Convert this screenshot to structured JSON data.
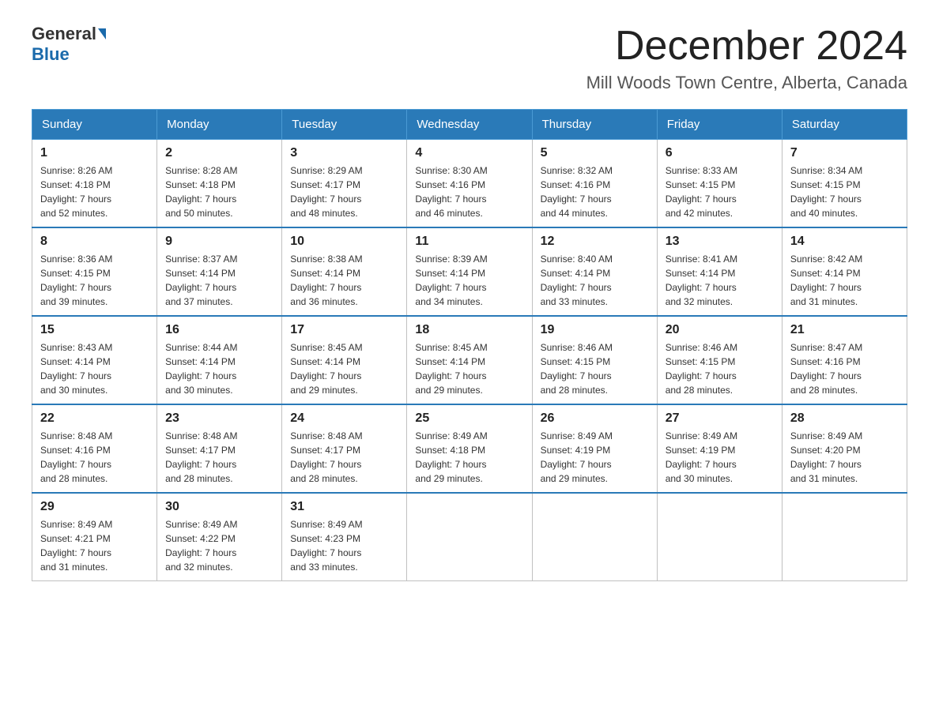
{
  "header": {
    "logo_general": "General",
    "logo_blue": "Blue",
    "month_title": "December 2024",
    "location": "Mill Woods Town Centre, Alberta, Canada"
  },
  "weekdays": [
    "Sunday",
    "Monday",
    "Tuesday",
    "Wednesday",
    "Thursday",
    "Friday",
    "Saturday"
  ],
  "weeks": [
    [
      {
        "day": "1",
        "sunrise": "8:26 AM",
        "sunset": "4:18 PM",
        "daylight": "7 hours and 52 minutes."
      },
      {
        "day": "2",
        "sunrise": "8:28 AM",
        "sunset": "4:18 PM",
        "daylight": "7 hours and 50 minutes."
      },
      {
        "day": "3",
        "sunrise": "8:29 AM",
        "sunset": "4:17 PM",
        "daylight": "7 hours and 48 minutes."
      },
      {
        "day": "4",
        "sunrise": "8:30 AM",
        "sunset": "4:16 PM",
        "daylight": "7 hours and 46 minutes."
      },
      {
        "day": "5",
        "sunrise": "8:32 AM",
        "sunset": "4:16 PM",
        "daylight": "7 hours and 44 minutes."
      },
      {
        "day": "6",
        "sunrise": "8:33 AM",
        "sunset": "4:15 PM",
        "daylight": "7 hours and 42 minutes."
      },
      {
        "day": "7",
        "sunrise": "8:34 AM",
        "sunset": "4:15 PM",
        "daylight": "7 hours and 40 minutes."
      }
    ],
    [
      {
        "day": "8",
        "sunrise": "8:36 AM",
        "sunset": "4:15 PM",
        "daylight": "7 hours and 39 minutes."
      },
      {
        "day": "9",
        "sunrise": "8:37 AM",
        "sunset": "4:14 PM",
        "daylight": "7 hours and 37 minutes."
      },
      {
        "day": "10",
        "sunrise": "8:38 AM",
        "sunset": "4:14 PM",
        "daylight": "7 hours and 36 minutes."
      },
      {
        "day": "11",
        "sunrise": "8:39 AM",
        "sunset": "4:14 PM",
        "daylight": "7 hours and 34 minutes."
      },
      {
        "day": "12",
        "sunrise": "8:40 AM",
        "sunset": "4:14 PM",
        "daylight": "7 hours and 33 minutes."
      },
      {
        "day": "13",
        "sunrise": "8:41 AM",
        "sunset": "4:14 PM",
        "daylight": "7 hours and 32 minutes."
      },
      {
        "day": "14",
        "sunrise": "8:42 AM",
        "sunset": "4:14 PM",
        "daylight": "7 hours and 31 minutes."
      }
    ],
    [
      {
        "day": "15",
        "sunrise": "8:43 AM",
        "sunset": "4:14 PM",
        "daylight": "7 hours and 30 minutes."
      },
      {
        "day": "16",
        "sunrise": "8:44 AM",
        "sunset": "4:14 PM",
        "daylight": "7 hours and 30 minutes."
      },
      {
        "day": "17",
        "sunrise": "8:45 AM",
        "sunset": "4:14 PM",
        "daylight": "7 hours and 29 minutes."
      },
      {
        "day": "18",
        "sunrise": "8:45 AM",
        "sunset": "4:14 PM",
        "daylight": "7 hours and 29 minutes."
      },
      {
        "day": "19",
        "sunrise": "8:46 AM",
        "sunset": "4:15 PM",
        "daylight": "7 hours and 28 minutes."
      },
      {
        "day": "20",
        "sunrise": "8:46 AM",
        "sunset": "4:15 PM",
        "daylight": "7 hours and 28 minutes."
      },
      {
        "day": "21",
        "sunrise": "8:47 AM",
        "sunset": "4:16 PM",
        "daylight": "7 hours and 28 minutes."
      }
    ],
    [
      {
        "day": "22",
        "sunrise": "8:48 AM",
        "sunset": "4:16 PM",
        "daylight": "7 hours and 28 minutes."
      },
      {
        "day": "23",
        "sunrise": "8:48 AM",
        "sunset": "4:17 PM",
        "daylight": "7 hours and 28 minutes."
      },
      {
        "day": "24",
        "sunrise": "8:48 AM",
        "sunset": "4:17 PM",
        "daylight": "7 hours and 28 minutes."
      },
      {
        "day": "25",
        "sunrise": "8:49 AM",
        "sunset": "4:18 PM",
        "daylight": "7 hours and 29 minutes."
      },
      {
        "day": "26",
        "sunrise": "8:49 AM",
        "sunset": "4:19 PM",
        "daylight": "7 hours and 29 minutes."
      },
      {
        "day": "27",
        "sunrise": "8:49 AM",
        "sunset": "4:19 PM",
        "daylight": "7 hours and 30 minutes."
      },
      {
        "day": "28",
        "sunrise": "8:49 AM",
        "sunset": "4:20 PM",
        "daylight": "7 hours and 31 minutes."
      }
    ],
    [
      {
        "day": "29",
        "sunrise": "8:49 AM",
        "sunset": "4:21 PM",
        "daylight": "7 hours and 31 minutes."
      },
      {
        "day": "30",
        "sunrise": "8:49 AM",
        "sunset": "4:22 PM",
        "daylight": "7 hours and 32 minutes."
      },
      {
        "day": "31",
        "sunrise": "8:49 AM",
        "sunset": "4:23 PM",
        "daylight": "7 hours and 33 minutes."
      },
      null,
      null,
      null,
      null
    ]
  ],
  "labels": {
    "sunrise": "Sunrise:",
    "sunset": "Sunset:",
    "daylight": "Daylight:"
  }
}
